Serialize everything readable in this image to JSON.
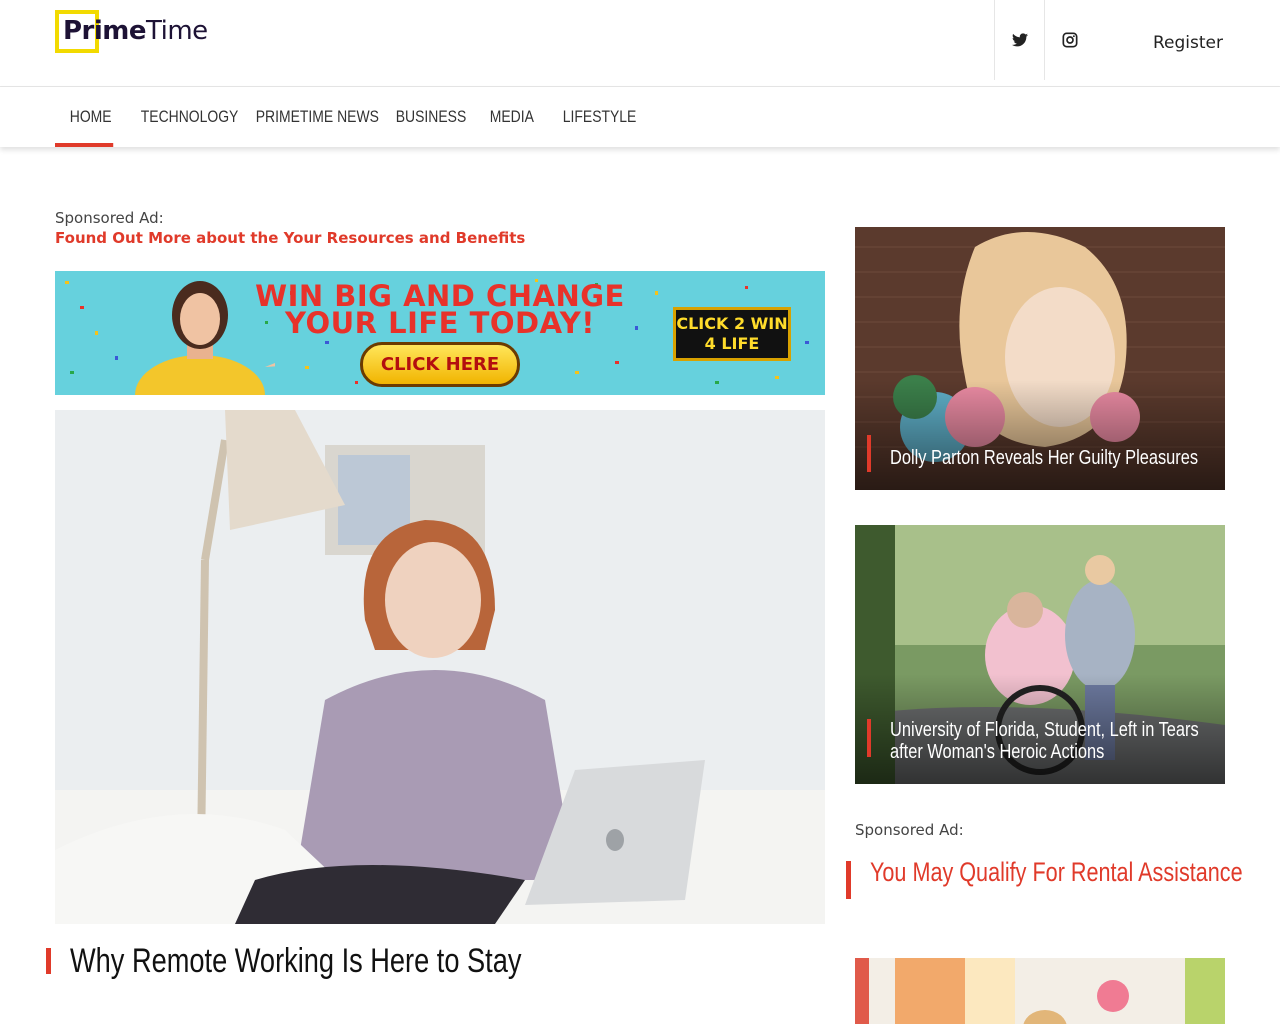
{
  "header": {
    "logo": {
      "bold": "Prime",
      "light": "Time"
    },
    "social": [
      "twitter-icon",
      "instagram-icon"
    ],
    "register_label": "Register"
  },
  "nav": {
    "items": [
      "HOME",
      "TECHNOLOGY",
      "PRIMETIME NEWS",
      "BUSINESS",
      "MEDIA",
      "LIFESTYLE"
    ],
    "active_index": 0
  },
  "left": {
    "sponsor_label": "Sponsored Ad:",
    "sponsor_link": "Found Out More about the Your Resources and Benefits",
    "banner": {
      "headline_line1": "WIN BIG AND CHANGE",
      "headline_line2": "YOUR LIFE TODAY!",
      "cta": "CLICK HERE",
      "badge_line1": "CLICK 2 WIN",
      "badge_line2": "4 LIFE"
    },
    "article_title": "Why Remote Working Is Here to Stay"
  },
  "right": {
    "cards": [
      {
        "title": "Dolly Parton Reveals Her Guilty Pleasures"
      },
      {
        "title": "University of Florida, Student, Left in Tears after Woman's Heroic Actions"
      }
    ],
    "sponsor_label": "Sponsored Ad:",
    "sponsor_link": "You May Qualify For Rental Assistance"
  },
  "colors": {
    "accent": "#e03a2a",
    "logo_yellow": "#f2da00",
    "logo_text": "#1d1235",
    "banner_bg": "#66d1dd"
  }
}
